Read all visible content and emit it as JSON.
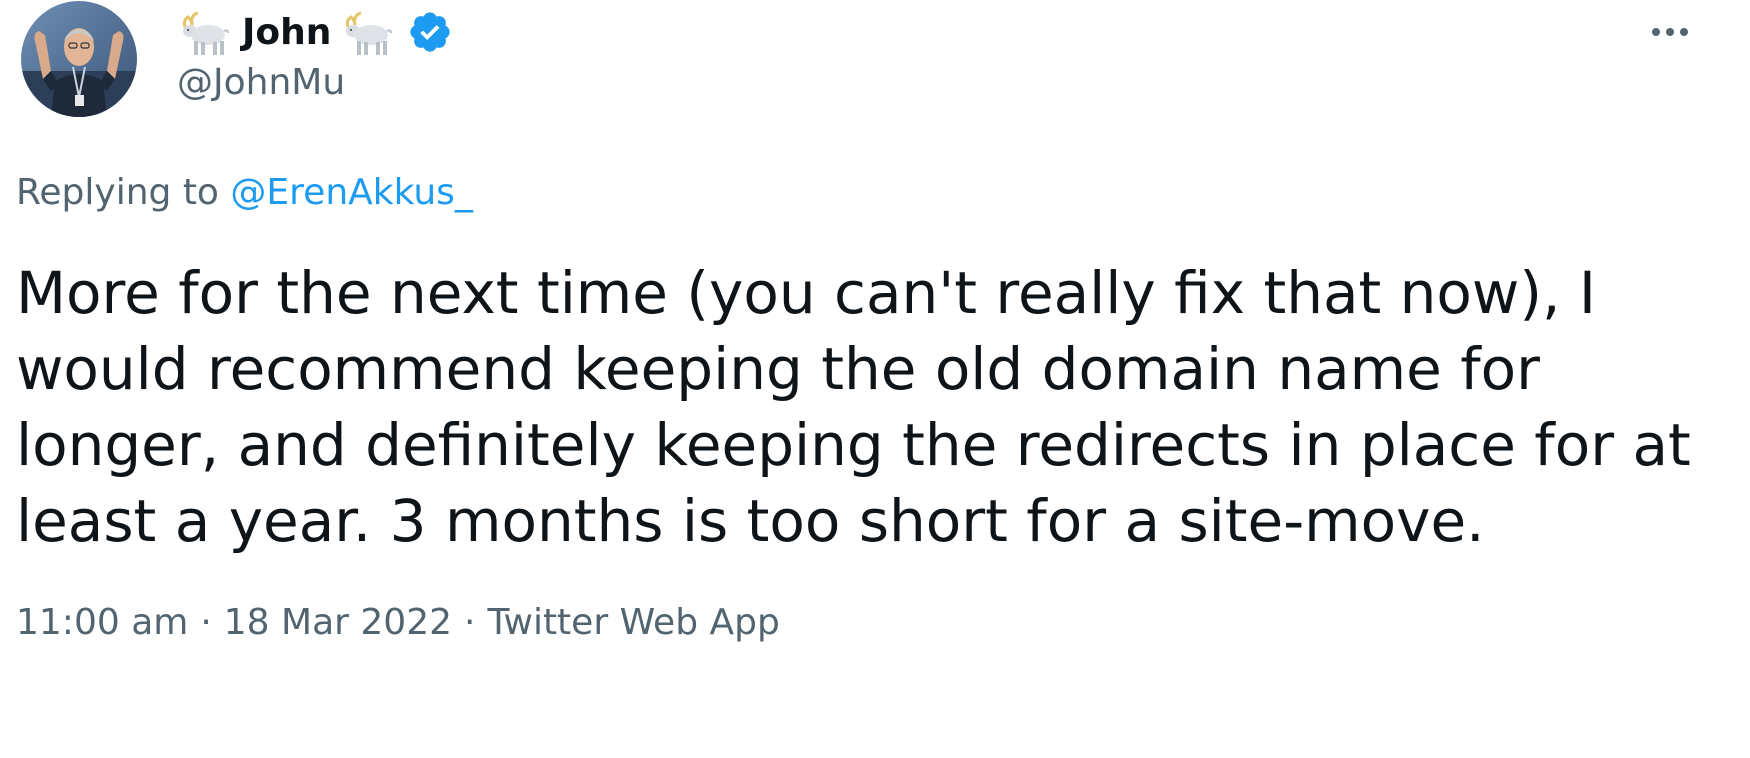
{
  "author": {
    "display_name": "John",
    "handle": "@JohnMu",
    "verified": true,
    "avatar_icon": "profile-photo",
    "name_emoji": "goat-icon"
  },
  "reply": {
    "prefix": "Replying to",
    "target": "@ErenAkkus_"
  },
  "tweet": {
    "text": "More for the next time (you can't really fix that now), I would recommend keeping the old domain name for longer, and definitely keeping the redirects in place for at least a year. 3 months is too short for a site-move."
  },
  "meta": {
    "time": "11:00 am",
    "date": "18 Mar 2022",
    "source": "Twitter Web App",
    "separator": "·"
  },
  "colors": {
    "text": "#0f1419",
    "secondary": "#536471",
    "link": "#1d9bf0",
    "verified": "#1d9bf0"
  }
}
